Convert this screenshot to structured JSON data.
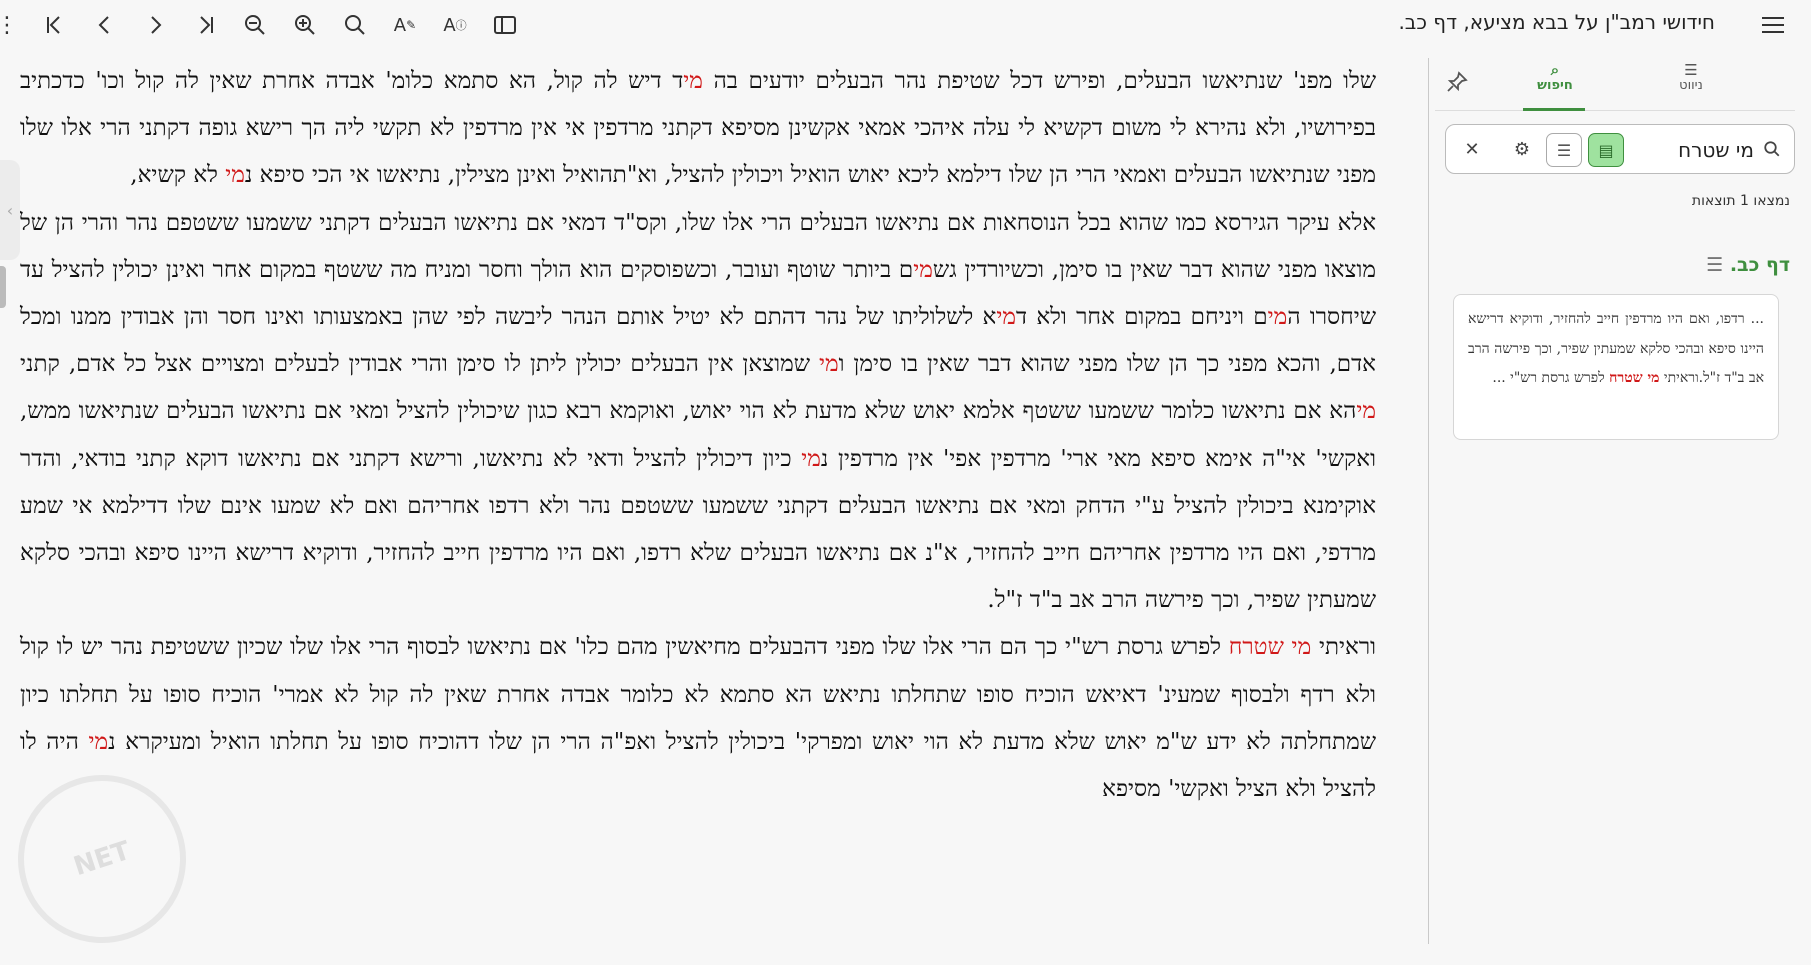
{
  "toolbar": {
    "title": "חידושי רמב\"ן על בבא מציעא, דף כב.",
    "menu_icon": "hamburger-icon",
    "buttons": {
      "more": "⋮",
      "first": "first-page-icon",
      "prev": "prev-page-icon",
      "next": "next-page-icon",
      "last": "last-page-icon",
      "zoom_out": "zoom-out-icon",
      "zoom_in": "zoom-in-icon",
      "search": "search-icon",
      "font_settings": "font-settings-icon",
      "font_info": "font-info-icon",
      "toggle_panel": "panel-toggle-icon"
    }
  },
  "reader": {
    "paragraphs": [
      [
        {
          "t": "שלו מפנ' שנתיאשו הבעלים, ופירש דכל שטיפת נהר הבעלים יודעים בה "
        },
        {
          "t": "מי",
          "h": true
        },
        {
          "t": "ד דיש לה קול, הא סתמא כלומ' אבדה אחרת שאין לה קול וכו' כדכתיב בפירושיו, ולא נהירא לי משום דקשיא לי עלה איהכי אמאי אקשינן מסיפא דקתני מרדפין אי אין מרדפין לא תקשי ליה הך רישא גופה דקתני הרי אלו שלו מפני שנתיאשו הבעלים ואמאי הרי הן שלו דילמא ליכא יאוש הואיל ויכולין להציל, וא\"תהואיל ואינן מצילין, נתיאשו אי הכי סיפא נ"
        },
        {
          "t": "מי",
          "h": true
        },
        {
          "t": " לא קשיא,"
        }
      ],
      [
        {
          "t": "אלא עיקר הגירסא כמו שהוא בכל הנוסחאות אם נתיאשו הבעלים הרי אלו שלו, וקס\"ד דמאי אם נתיאשו הבעלים דקתני ששמעו ששטפם נהר והרי הן של מוצאו מפני שהוא דבר שאין בו סימן, וכשיורדין גש"
        },
        {
          "t": "מי",
          "h": true
        },
        {
          "t": "ם ביותר שוטף ועובר, וכשפוסקים הוא הולך וחסר ומניח מה ששטף במקום אחר ואינן יכולין להציל עד שיחסרו ה"
        },
        {
          "t": "מי",
          "h": true
        },
        {
          "t": "ם ויניחם במקום אחר ולא ד"
        },
        {
          "t": "מי",
          "h": true
        },
        {
          "t": "א לשלוליתו של נהר דהתם לא יטיל אותם הנהר ליבשה לפי שהן באמצעותו ואינו חסר והן אבודין ממנו ומכל אדם, והכא מפני כך הן שלו מפני שהוא דבר שאין בו סימן ו"
        },
        {
          "t": "מי",
          "h": true
        },
        {
          "t": " שמוצאן אין הבעלים יכולין ליתן לו סימן והרי אבודין לבעלים ומצויים אצל כל אדם, קתני "
        },
        {
          "t": "מי",
          "h": true
        },
        {
          "t": "הא אם נתיאשו כלומר ששמעו ששטף אלמא יאוש שלא מדעת לא הוי יאוש, ואוקמא רבא כגון שיכולין להציל ומאי אם נתיאשו הבעלים שנתיאשו ממש, ואקשי' אי\"ה אימא סיפא מאי ארי' מרדפין אפי' אין מרדפין נ"
        },
        {
          "t": "מי",
          "h": true
        },
        {
          "t": " כיון דיכולין להציל ודאי לא נתיאשו, ורישא דקתני אם נתיאשו דוקא קתני בודאי, והדר אוקימנא ביכולין להציל ע\"י הדחק ומאי אם נתיאשו הבעלים דקתני ששמעו ששטפם נהר ולא רדפו אחריהם ואם לא שמעו אינם שלו דדילמא אי שמע מרדפי, ואם היו מרדפין אחריהם חייב להחזיר, א\"נ אם נתיאשו הבעלים שלא רדפו, ואם היו מרדפין חייב להחזיר, ודוקיא דרישא היינו סיפא ובהכי סלקא שמעתין שפיר, וכך פירשה הרב אב ב\"ד ז\"ל."
        }
      ],
      [
        {
          "t": "וראיתי "
        },
        {
          "t": "מי שטרח",
          "h": true
        },
        {
          "t": " לפרש גרסת רש\"י כך הם הרי אלו שלו מפני דהבעלים מחיאשין מהם כלו' אם נתיאשו לבסוף הרי אלו שלו שכיון ששטיפת נהר יש לו קול ולא רדף ולבסוף שמעינ' דאיאש הוכיח סופו שתחלתו נתיאש הא סתמא לא כלומר אבדה אחרת שאין לה קול לא אמרי' הוכיח סופו על תחלתו כיון שמתחלתה לא ידע ש\"מ יאוש שלא מדעת לא הוי יאוש ומפרקי' ביכולין להציל ואפ\"ה הרי הן שלו דהוכיח סופו על תחלתו הואיל ומעיקרא נ"
        },
        {
          "t": "מי",
          "h": true
        },
        {
          "t": " היה לו להציל ולא הציל ואקשי' מסיפא"
        }
      ]
    ]
  },
  "sidebar": {
    "tabs": [
      {
        "label": "ניווט",
        "icon": "navigation-icon"
      },
      {
        "label": "חיפוש",
        "icon": "search-icon"
      }
    ],
    "pin_icon": "pin-icon",
    "search": {
      "value": "מי שטרח",
      "placeholder": "",
      "search_icon": "search-icon",
      "book_toggle": "book-icon",
      "text_toggle": "text-lines-icon",
      "settings_icon": "gear-icon",
      "clear_icon": "close-icon"
    },
    "results_count": "נמצאו 1 תוצאות",
    "group_title": "דף כב.",
    "result": {
      "before": "... רדפו, ואם היו מרדפין חייב להחזיר, ודוקיא דרישא היינו סיפא ובהכי סלקא שמעתין שפיר, וכך פירשה הרב אב ב\"ד ז\"ל.וראיתי ",
      "match": "מי שטרח",
      "after": " לפרש גרסת רש\"י ..."
    }
  },
  "colors": {
    "highlight": "#d01818",
    "accent": "#3f8f3f",
    "background": "#f7f7f7"
  }
}
